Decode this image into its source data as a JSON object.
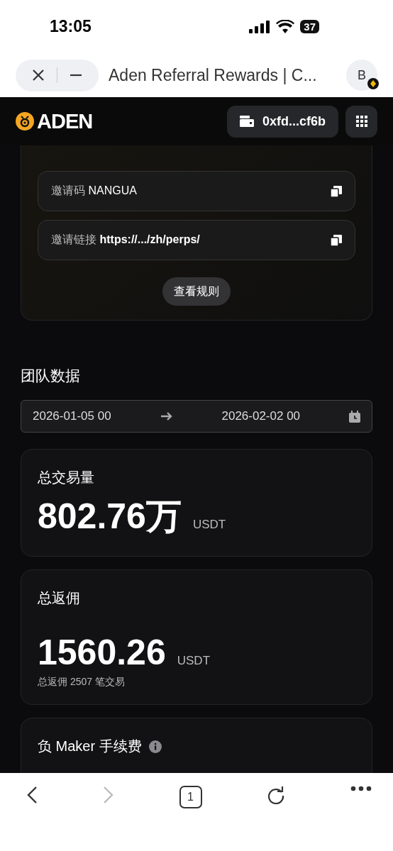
{
  "status_bar": {
    "time": "13:05",
    "battery": "37"
  },
  "browser": {
    "title": "Aden Referral Rewards | C...",
    "profile": "B"
  },
  "header": {
    "logo": "ADEN",
    "wallet": "0xfd...cf6b"
  },
  "invite": {
    "rows": [
      {
        "label": "邀请码",
        "value": "NANGUA",
        "bold": false
      },
      {
        "label": "邀请链接",
        "value": "https://.../zh/perps/",
        "bold": true
      }
    ],
    "rules_button": "查看规则"
  },
  "team": {
    "title": "团队数据",
    "date_from": "2026-01-05 00",
    "date_to": "2026-02-02 00"
  },
  "stats": [
    {
      "title": "总交易量",
      "value": "802.76万",
      "unit": "USDT",
      "info": false
    },
    {
      "title": "总返佣",
      "value": "1560.26",
      "unit": "USDT",
      "note": "总返佣 2507 笔交易",
      "info": false
    },
    {
      "title": "负 Maker 手续费",
      "info": true
    }
  ],
  "toolbar": {
    "tabs": "1",
    "forward_disabled": true
  }
}
